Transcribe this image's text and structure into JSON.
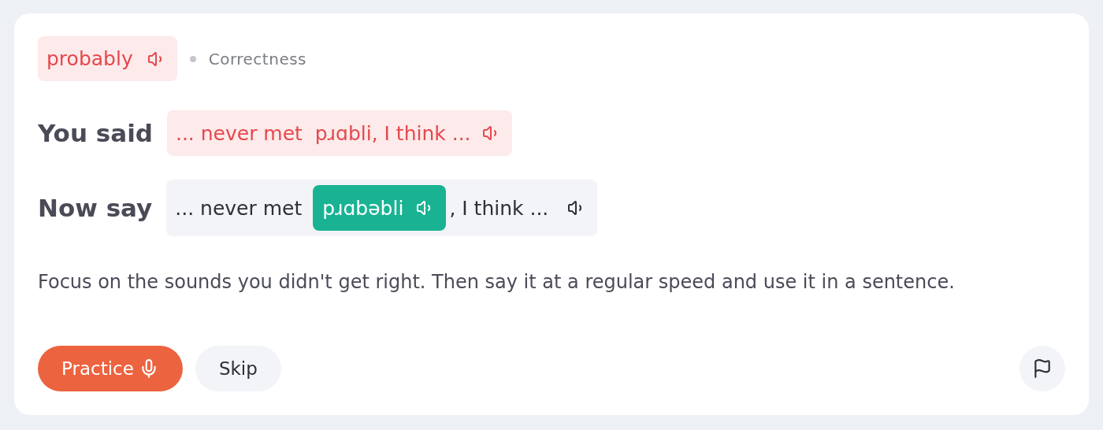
{
  "word": {
    "text": "probably",
    "category": "Correctness"
  },
  "you_said": {
    "label": "You said",
    "text": "... never met  pɹɑbli, I think ..."
  },
  "now_say": {
    "label": "Now say",
    "before": "... never met",
    "target": "pɹɑbəbli",
    "after": ", I think ..."
  },
  "hint": "Focus on the sounds you didn't get right. Then say it at a regular speed and use it in a sentence.",
  "buttons": [
    {
      "kind": "primary",
      "label": "Practice"
    },
    {
      "kind": "secondary",
      "label": "Skip"
    }
  ]
}
